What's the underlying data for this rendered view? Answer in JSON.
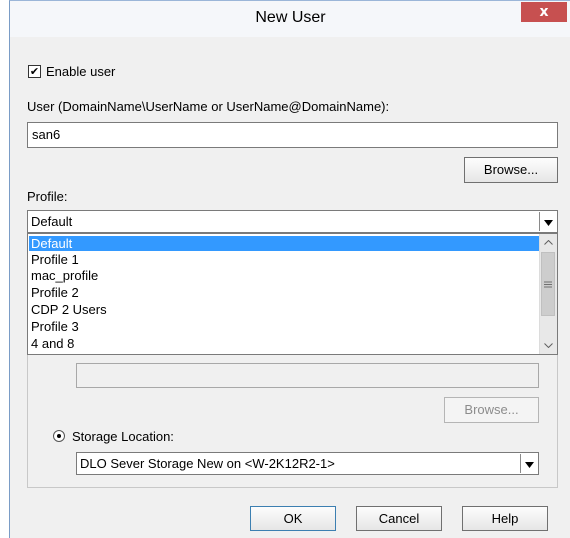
{
  "window": {
    "title": "New User",
    "close_label": "x"
  },
  "enable_user": {
    "label": "Enable user",
    "checked": true,
    "check_glyph": "✔"
  },
  "user_field": {
    "label": "User (DomainName\\UserName or UserName@DomainName):",
    "value": "san6"
  },
  "browse_user_label": "Browse...",
  "profile": {
    "label": "Profile:",
    "selected": "Default",
    "options": [
      "Default",
      "Profile 1",
      "mac_profile",
      "Profile 2",
      "CDP 2 Users",
      "Profile 3",
      "4 and 8"
    ]
  },
  "browse_disabled_label": "Browse...",
  "storage": {
    "label": "Storage Location:",
    "selected": "DLO Sever Storage New on <W-2K12R2-1>"
  },
  "buttons": {
    "ok": "OK",
    "cancel": "Cancel",
    "help": "Help"
  },
  "icons": {
    "dropdown": "chevron-down-icon",
    "scroll_up": "chevron-up-icon",
    "scroll_down": "chevron-down-icon",
    "scroll_grip": "grip-icon"
  },
  "colors": {
    "selection": "#3399ff",
    "close_button": "#c75050"
  }
}
